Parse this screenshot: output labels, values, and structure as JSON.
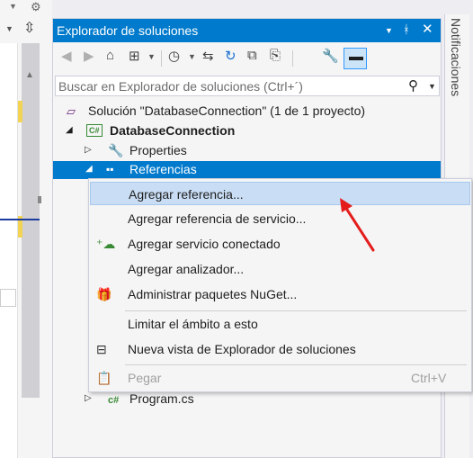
{
  "window": {
    "title": "Explorador de soluciones"
  },
  "notifications_tab": {
    "label": "Notificaciones"
  },
  "search": {
    "placeholder": "Buscar en Explorador de soluciones (Ctrl+´)"
  },
  "tree": {
    "solution": "Solución \"DatabaseConnection\" (1 de 1 proyecto)",
    "project": "DatabaseConnection",
    "properties": "Properties",
    "references": "Referencias",
    "program": "Program.cs"
  },
  "context_menu": {
    "items": [
      {
        "label": "Agregar referencia...",
        "icon": "none"
      },
      {
        "label": "Agregar referencia de servicio...",
        "icon": "none"
      },
      {
        "label": "Agregar servicio conectado",
        "icon": "connected-service-icon"
      },
      {
        "label": "Agregar analizador...",
        "icon": "none"
      },
      {
        "label": "Administrar paquetes NuGet...",
        "icon": "nuget-icon"
      },
      {
        "label": "Limitar el ámbito a esto",
        "icon": "none"
      },
      {
        "label": "Nueva vista de Explorador de soluciones",
        "icon": "new-view-icon"
      },
      {
        "label": "Pegar",
        "icon": "paste-icon",
        "shortcut": "Ctrl+V",
        "disabled": true
      }
    ]
  },
  "colors": {
    "accent": "#007acc",
    "menu_highlight": "#c9def5",
    "arrow": "#e51c1c",
    "csharp": "#388a34"
  }
}
